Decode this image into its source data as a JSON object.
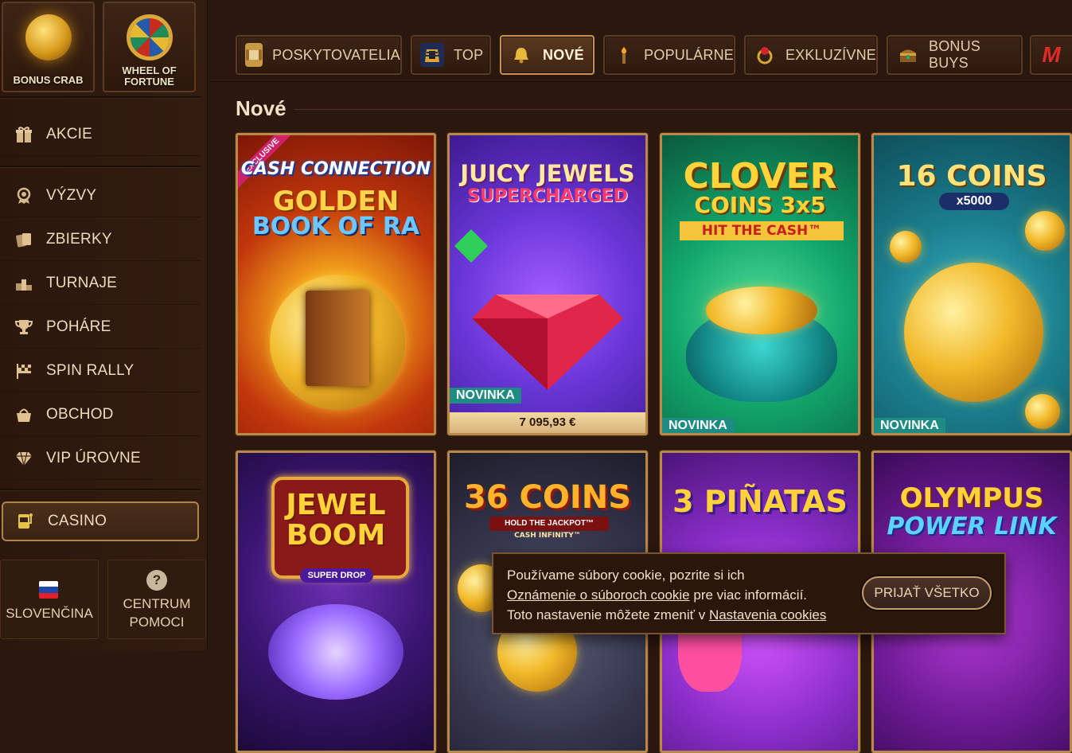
{
  "sidebar": {
    "promos": [
      {
        "label": "BONUS CRAB",
        "icon": "crab-coin-icon"
      },
      {
        "label": "WHEEL OF FORTUNE",
        "icon": "fortune-wheel-icon"
      }
    ],
    "akcie": {
      "label": "AKCIE",
      "icon": "gift-icon"
    },
    "items": [
      {
        "label": "VÝZVY",
        "icon": "badge-icon"
      },
      {
        "label": "ZBIERKY",
        "icon": "cards-icon"
      },
      {
        "label": "TURNAJE",
        "icon": "podium-icon"
      },
      {
        "label": "POHÁRE",
        "icon": "trophy-icon"
      },
      {
        "label": "SPIN RALLY",
        "icon": "checkered-flag-icon"
      },
      {
        "label": "OBCHOD",
        "icon": "basket-icon"
      },
      {
        "label": "VIP ÚROVNE",
        "icon": "diamond-icon"
      }
    ],
    "casino": {
      "label": "CASINO",
      "icon": "slot-machine-icon"
    },
    "language": {
      "label": "SLOVENČINA",
      "icon": "slovak-flag-icon"
    },
    "help": {
      "line1": "CENTRUM",
      "line2": "POMOCI",
      "icon": "question-icon"
    }
  },
  "tabs": [
    {
      "label": "POSKYTOVATELIA",
      "icon": "scroll-icon"
    },
    {
      "label": "TOP",
      "icon": "pharaoh-icon"
    },
    {
      "label": "NOVÉ",
      "icon": "bell-icon",
      "active": true
    },
    {
      "label": "POPULÁRNE",
      "icon": "torch-icon"
    },
    {
      "label": "EXKLUZÍVNE",
      "icon": "ruby-ring-icon"
    },
    {
      "label": "BONUS BUYS",
      "icon": "treasure-chest-icon"
    },
    {
      "label": "M",
      "icon": "m-logo-icon"
    }
  ],
  "section_title": "Nové",
  "games": [
    {
      "title_line1": "CASH CONNECTION",
      "title_line2": "GOLDEN",
      "title_line3": "BOOK OF RA",
      "corner": "EXCLUSIVE"
    },
    {
      "title_line1": "JUICY JEWELS",
      "title_line2": "SUPERCHARGED",
      "badge": "NOVINKA",
      "jackpot": "7 095,93 €"
    },
    {
      "title_line1": "CLOVER",
      "title_line2": "COINS 3x5",
      "title_line3": "HIT THE CASH™",
      "badge": "NOVINKA"
    },
    {
      "title_line1": "16 COINS",
      "title_line2": "x5000",
      "badge": "NOVINKA"
    },
    {
      "title_line1": "JEWEL",
      "title_line2": "BOOM",
      "title_line3": "SUPER DROP"
    },
    {
      "title_line1": "36 COINS",
      "title_line2": "HOLD THE JACKPOT™",
      "title_line3": "CASH INFINITY™"
    },
    {
      "title_line1": "3 PIÑATAS"
    },
    {
      "title_line1": "OLYMPUS",
      "title_line2": "POWER LINK"
    }
  ],
  "cookie": {
    "line1": "Používame súbory cookie, pozrite si ich",
    "link1": "Oznámenie o súboroch cookie",
    "line2_rest": " pre viac informácií.",
    "line3": "Toto nastavenie môžete zmeniť v ",
    "link2": "Nastavenia cookies",
    "accept_label": "PRIJAŤ VŠETKO"
  }
}
